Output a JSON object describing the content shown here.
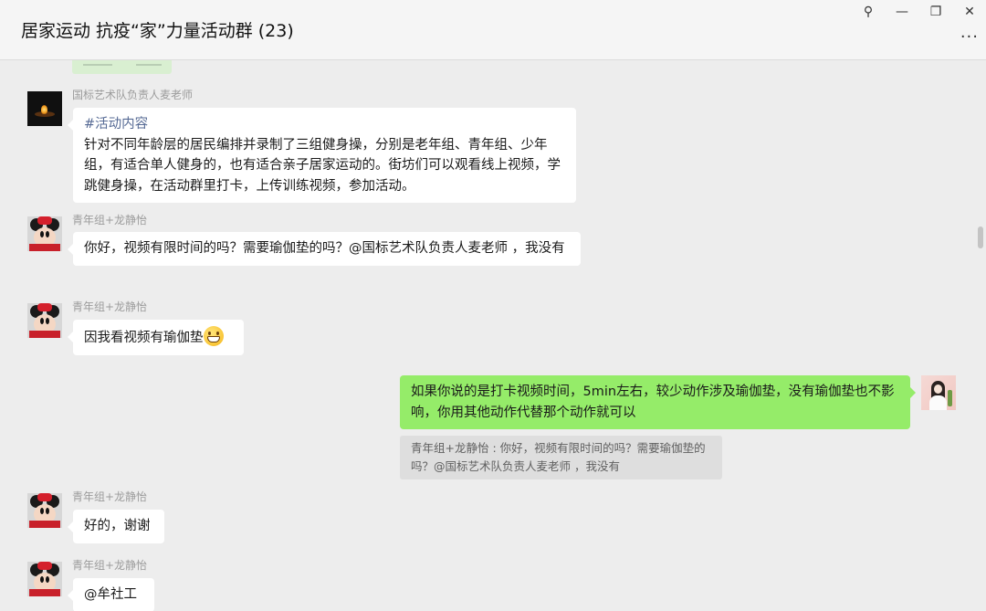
{
  "window": {
    "title": "居家运动 抗疫“家”力量活动群 (23)",
    "pin_glyph": "⚲",
    "minimize_glyph": "—",
    "restore_glyph": "❐",
    "close_glyph": "✕",
    "more_glyph": "···"
  },
  "messages": [
    {
      "sender": "国标艺术队负责人麦老师",
      "hashtag": "#活动内容",
      "text": "针对不同年龄层的居民编排并录制了三组健身操，分别是老年组、青年组、少年组，有适合单人健身的，也有适合亲子居家运动的。街坊们可以观看线上视频，学跳健身操，在活动群里打卡，上传训练视频，参加活动。"
    },
    {
      "sender": "青年组+龙静怡",
      "text": "你好，视频有限时间的吗？需要瑜伽垫的吗？@国标艺术队负责人麦老师 ，我没有"
    },
    {
      "sender": "青年组+龙静怡",
      "text": "因我看视频有瑜伽垫"
    },
    {
      "sender": "",
      "text": "如果你说的是打卡视频时间，5min左右，较少动作涉及瑜伽垫，没有瑜伽垫也不影响，你用其他动作代替那个动作就可以",
      "quote": "青年组+龙静怡 : 你好，视频有限时间的吗？需要瑜伽垫的吗？@国标艺术队负责人麦老师 ，我没有"
    },
    {
      "sender": "青年组+龙静怡",
      "text": "好的，谢谢"
    },
    {
      "sender": "青年组+龙静怡",
      "text": "@牟社工"
    }
  ]
}
